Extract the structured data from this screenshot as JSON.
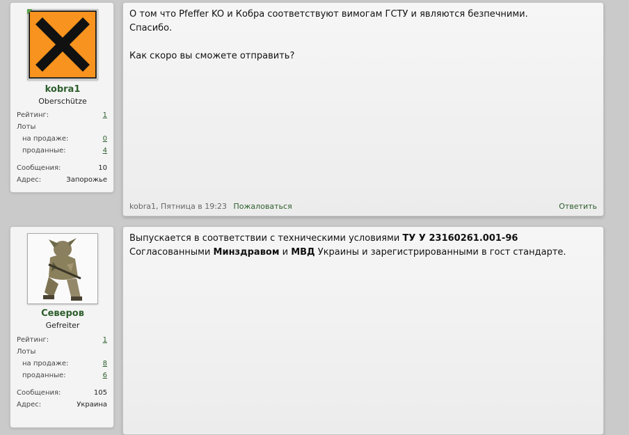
{
  "posts": [
    {
      "user": {
        "name": "kobra1",
        "title": "Oberschütze",
        "avatar_icon": "hazard-x-icon",
        "rating_label": "Рейтинг:",
        "rating": "1",
        "lots_label": "Лоты",
        "on_sale_label": "на продаже:",
        "on_sale": "0",
        "sold_label": "проданные:",
        "sold": "4",
        "messages_label": "Сообщения:",
        "messages": "10",
        "address_label": "Адрес:",
        "address": "Запорожье"
      },
      "message": {
        "line1": "О том что Pfeffer KO и Кобра соответствуют вимогам ГСТУ и являются безпечними.",
        "line2": "Спасибо.",
        "line3": "Как скоро вы сможете отправить?"
      },
      "footer": {
        "meta": "kobra1, Пятница в 19:23",
        "report": "Пожаловаться",
        "reply": "Ответить"
      }
    },
    {
      "user": {
        "name": "Северов",
        "title": "Gefreiter",
        "avatar_icon": "soldier-photo",
        "rating_label": "Рейтинг:",
        "rating": "1",
        "lots_label": "Лоты",
        "on_sale_label": "на продаже:",
        "on_sale": "8",
        "sold_label": "проданные:",
        "sold": "6",
        "messages_label": "Сообщения:",
        "messages": "105",
        "address_label": "Адрес:",
        "address": "Украина"
      },
      "message": {
        "l1_a": "Выпускается в соответствии с техническими условиями ",
        "l1_b": "ТУ У 23160261.001-96",
        "l2_a": "Согласованными ",
        "l2_b": "Минздравом",
        "l2_c": " и ",
        "l2_d": "МВД",
        "l2_e": " Украины и зарегистрированными в гост стандарте."
      }
    }
  ]
}
